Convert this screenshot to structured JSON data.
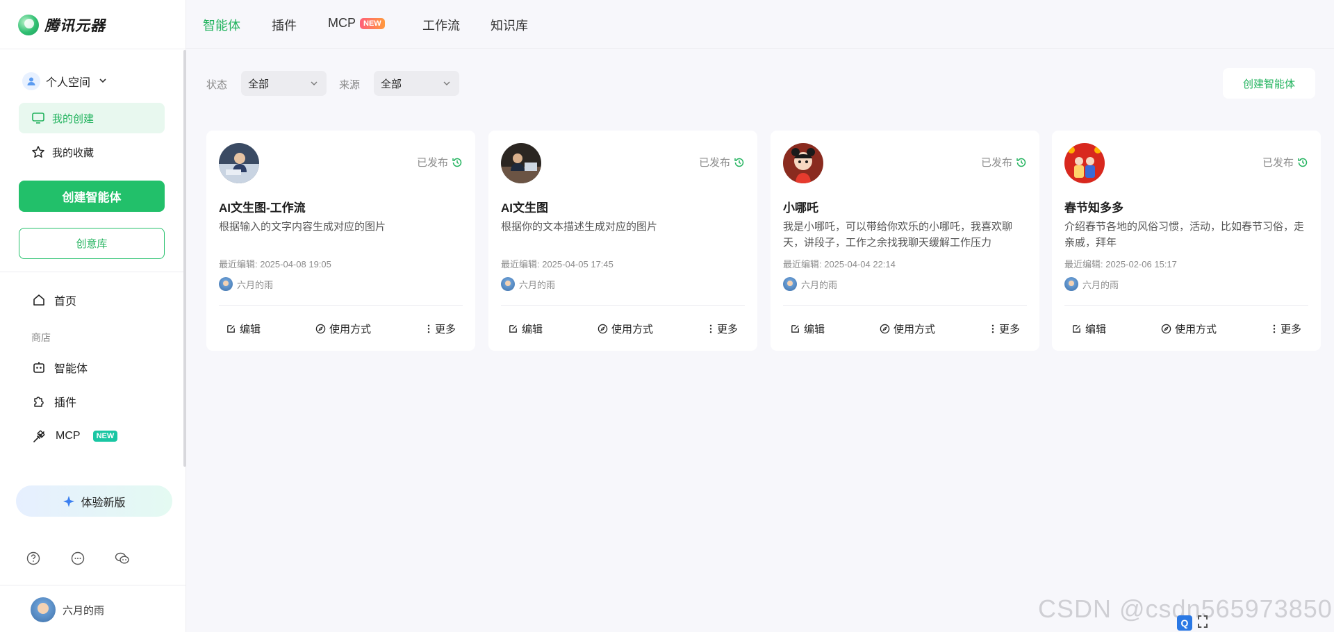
{
  "brand": {
    "name": "腾讯元器"
  },
  "top_tabs": [
    {
      "label": "智能体"
    },
    {
      "label": "插件"
    },
    {
      "label": "MCP",
      "badge": "NEW"
    },
    {
      "label": "工作流"
    },
    {
      "label": "知识库"
    }
  ],
  "sidebar": {
    "space": "个人空间",
    "my_create": "我的创建",
    "my_favorites": "我的收藏",
    "create_agent": "创建智能体",
    "idea_library": "创意库",
    "home": "首页",
    "store_label": "商店",
    "agent": "智能体",
    "plugin": "插件",
    "mcp": "MCP",
    "mcp_badge": "NEW",
    "try_new": "体验新版",
    "user": "六月的雨"
  },
  "filters": {
    "status_label": "状态",
    "status_value": "全部",
    "source_label": "来源",
    "source_value": "全部",
    "create_button": "创建智能体"
  },
  "cards": [
    {
      "title": "AI文生图-工作流",
      "status": "已发布",
      "desc": "根据输入的文字内容生成对应的图片",
      "edited": "最近编辑: 2025-04-08 19:05",
      "author": "六月的雨",
      "actions": {
        "edit": "编辑",
        "usage": "使用方式",
        "more": "更多"
      }
    },
    {
      "title": "AI文生图",
      "status": "已发布",
      "desc": "根据你的文本描述生成对应的图片",
      "edited": "最近编辑: 2025-04-05 17:45",
      "author": "六月的雨",
      "actions": {
        "edit": "编辑",
        "usage": "使用方式",
        "more": "更多"
      }
    },
    {
      "title": "小哪吒",
      "status": "已发布",
      "desc": "我是小哪吒，可以带给你欢乐的小哪吒，我喜欢聊天，讲段子，工作之余找我聊天缓解工作压力",
      "edited": "最近编辑: 2025-04-04 22:14",
      "author": "六月的雨",
      "actions": {
        "edit": "编辑",
        "usage": "使用方式",
        "more": "更多"
      }
    },
    {
      "title": "春节知多多",
      "status": "已发布",
      "desc": "介绍春节各地的风俗习惯，活动，比如春节习俗，走亲戚，拜年",
      "edited": "最近编辑: 2025-02-06 15:17",
      "author": "六月的雨",
      "actions": {
        "edit": "编辑",
        "usage": "使用方式",
        "more": "更多"
      }
    }
  ],
  "watermark": "CSDN @csdn565973850",
  "colors": {
    "accent": "#22c06a",
    "accent_text": "#22b35e",
    "background": "#f7f7fb"
  }
}
